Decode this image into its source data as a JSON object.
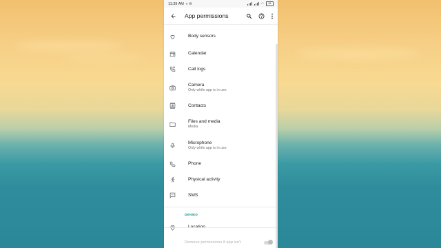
{
  "statusbar": {
    "time": "11:39 AM",
    "battery": "64"
  },
  "appbar": {
    "title": "App permissions"
  },
  "allowed_items": [
    {
      "label": "Body sensors",
      "sub": "",
      "icon": "heart-icon"
    },
    {
      "label": "Calendar",
      "sub": "",
      "icon": "calendar-icon"
    },
    {
      "label": "Call logs",
      "sub": "",
      "icon": "call-log-icon"
    },
    {
      "label": "Camera",
      "sub": "Only while app is in use",
      "icon": "camera-icon"
    },
    {
      "label": "Contacts",
      "sub": "",
      "icon": "contacts-icon"
    },
    {
      "label": "Files and media",
      "sub": "Media",
      "icon": "folder-icon"
    },
    {
      "label": "Microphone",
      "sub": "Only while app is in use",
      "icon": "microphone-icon"
    },
    {
      "label": "Phone",
      "sub": "",
      "icon": "phone-icon"
    },
    {
      "label": "Physical activity",
      "sub": "",
      "icon": "walking-icon"
    },
    {
      "label": "SMS",
      "sub": "",
      "icon": "sms-icon"
    }
  ],
  "denied_section": {
    "header": "DENIED",
    "items": [
      {
        "label": "Location",
        "icon": "location-icon"
      }
    ]
  },
  "bottom": {
    "label": "Remove permissions if app isn't"
  },
  "colors": {
    "accent": "#1a8f82",
    "text_primary": "#202124",
    "text_secondary": "#70757a"
  }
}
